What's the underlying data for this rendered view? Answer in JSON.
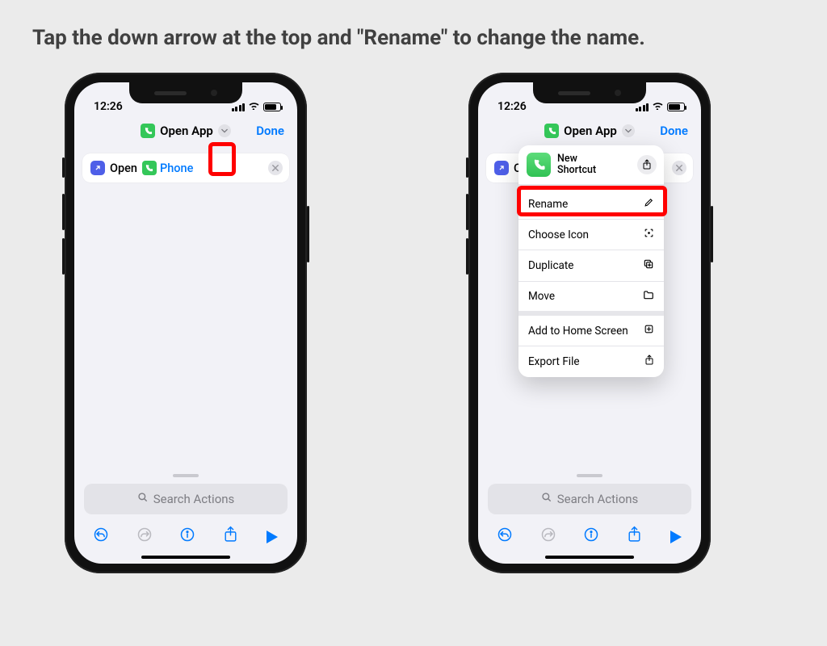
{
  "instruction": "Tap the down arrow at the top and \"Rename\" to change the name.",
  "status": {
    "time": "12:26"
  },
  "nav": {
    "shortcut_title": "Open App",
    "done": "Done"
  },
  "action_card": {
    "open_label": "Open",
    "app_name": "Phone",
    "open_initial": "O"
  },
  "search": {
    "placeholder": "Search Actions"
  },
  "popover": {
    "title": "New Shortcut",
    "items_a": [
      {
        "label": "Rename"
      },
      {
        "label": "Choose Icon"
      },
      {
        "label": "Duplicate"
      },
      {
        "label": "Move"
      }
    ],
    "items_b": [
      {
        "label": "Add to Home Screen"
      },
      {
        "label": "Export File"
      }
    ]
  }
}
